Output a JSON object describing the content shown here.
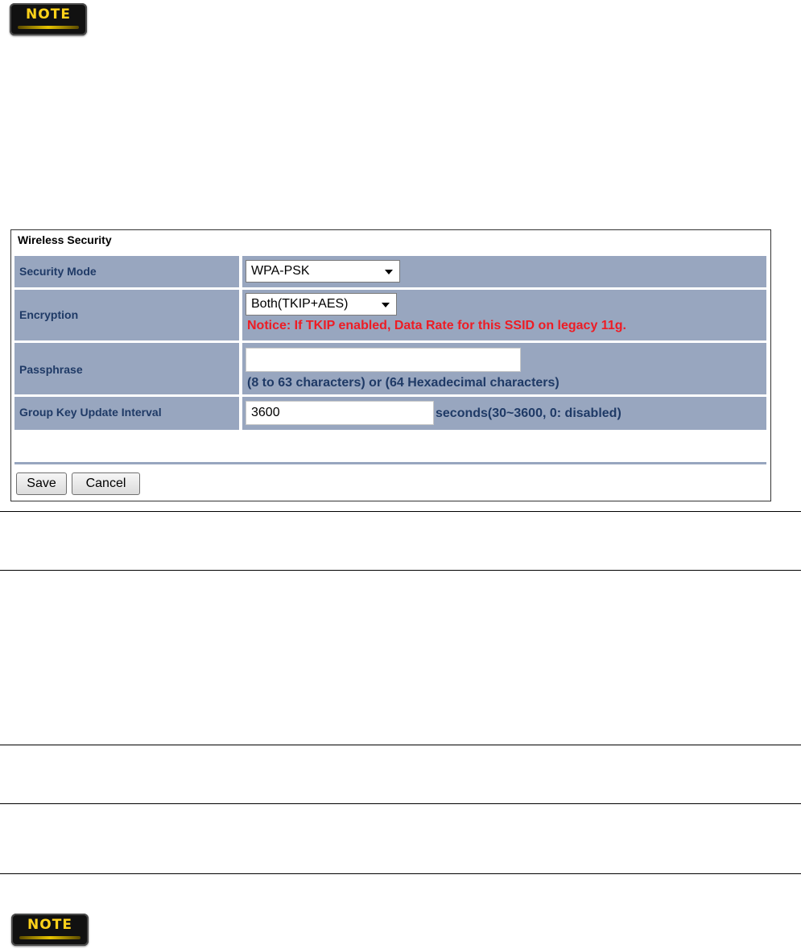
{
  "note_badges": {
    "top_label": "NOTE",
    "bottom_label": "NOTE"
  },
  "wireless_security": {
    "title": "Wireless Security",
    "security_mode": {
      "label": "Security Mode",
      "selected": "WPA-PSK"
    },
    "encryption": {
      "label": "Encryption",
      "selected": "Both(TKIP+AES)",
      "notice": "Notice: If TKIP enabled, Data Rate for this SSID on legacy 11g."
    },
    "passphrase": {
      "label": "Passphrase",
      "value": "",
      "hint": "(8 to 63 characters) or (64 Hexadecimal characters)"
    },
    "group_key_update_interval": {
      "label": "Group Key Update Interval",
      "value": "3600",
      "hint": "seconds(30~3600, 0: disabled)"
    },
    "buttons": {
      "save_label": "Save",
      "cancel_label": "Cancel"
    }
  },
  "colors": {
    "row_background": "#98a6bf",
    "label_text": "#1f3a66",
    "notice_text": "#ee1c24",
    "note_badge_text": "#ffd21a"
  }
}
